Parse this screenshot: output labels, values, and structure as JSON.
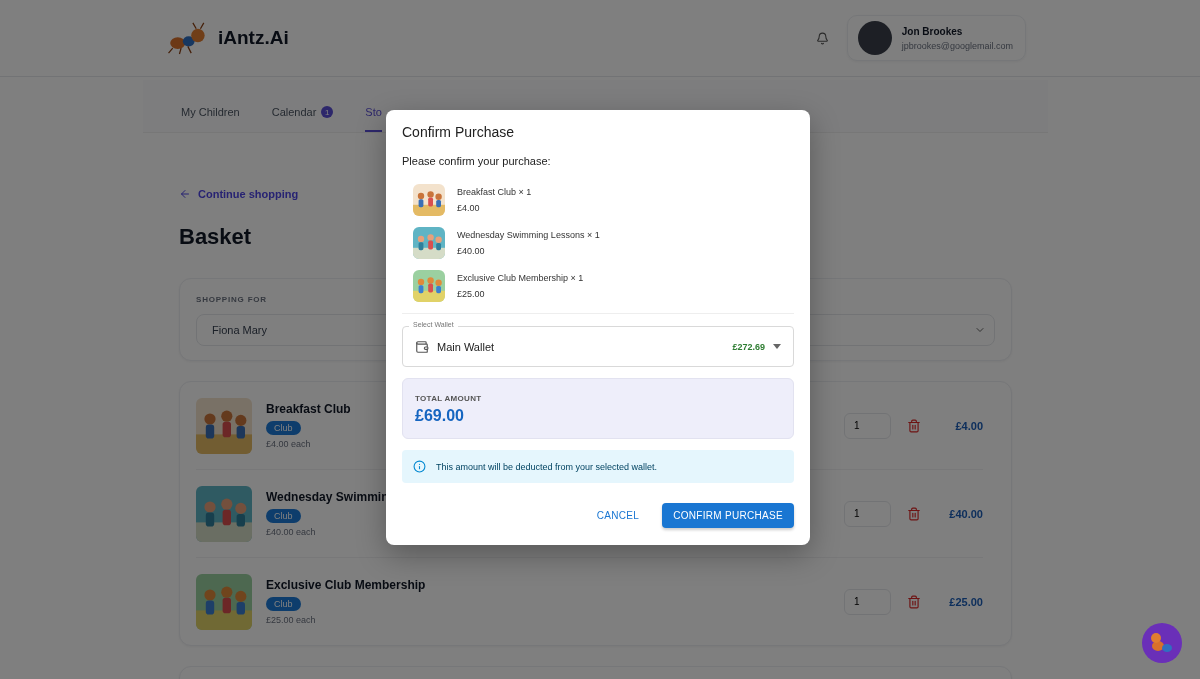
{
  "header": {
    "brand": "iAntz.Ai",
    "user": {
      "name": "Jon Brookes",
      "email": "jpbrookes@googlemail.com"
    }
  },
  "nav": {
    "tabs": [
      {
        "label": "My Children",
        "selected": false
      },
      {
        "label": "Calendar",
        "selected": false,
        "badge": "1"
      },
      {
        "label": "Sto",
        "selected": true
      }
    ]
  },
  "back_link": "Continue shopping",
  "page_title": "Basket",
  "shopping_for": {
    "label": "SHOPPING FOR",
    "value": "Fiona Mary"
  },
  "basket_items": [
    {
      "name": "Breakfast Club",
      "tag": "Club",
      "price_each": "£4.00 each",
      "quantity": "1",
      "total": "£4.00"
    },
    {
      "name": "Wednesday Swimmin",
      "tag": "Club",
      "price_each": "£40.00 each",
      "quantity": "1",
      "total": "£40.00"
    },
    {
      "name": "Exclusive Club Membership",
      "tag": "Club",
      "price_each": "£25.00 each",
      "quantity": "1",
      "total": "£25.00"
    }
  ],
  "dialog": {
    "title": "Confirm Purchase",
    "prompt": "Please confirm your purchase:",
    "items": [
      {
        "name": "Breakfast Club × 1",
        "price": "£4.00"
      },
      {
        "name": "Wednesday Swimming Lessons × 1",
        "price": "£40.00"
      },
      {
        "name": "Exclusive Club Membership × 1",
        "price": "£25.00"
      }
    ],
    "wallet": {
      "label": "Select Wallet",
      "value": "Main Wallet",
      "balance": "£272.69"
    },
    "total": {
      "label": "TOTAL AMOUNT",
      "amount": "£69.00"
    },
    "info": "This amount will be deducted from your selected wallet.",
    "buttons": [
      {
        "label": "CANCEL",
        "kind": "text"
      },
      {
        "label": "CONFIRM PURCHASE",
        "kind": "contained"
      }
    ]
  }
}
